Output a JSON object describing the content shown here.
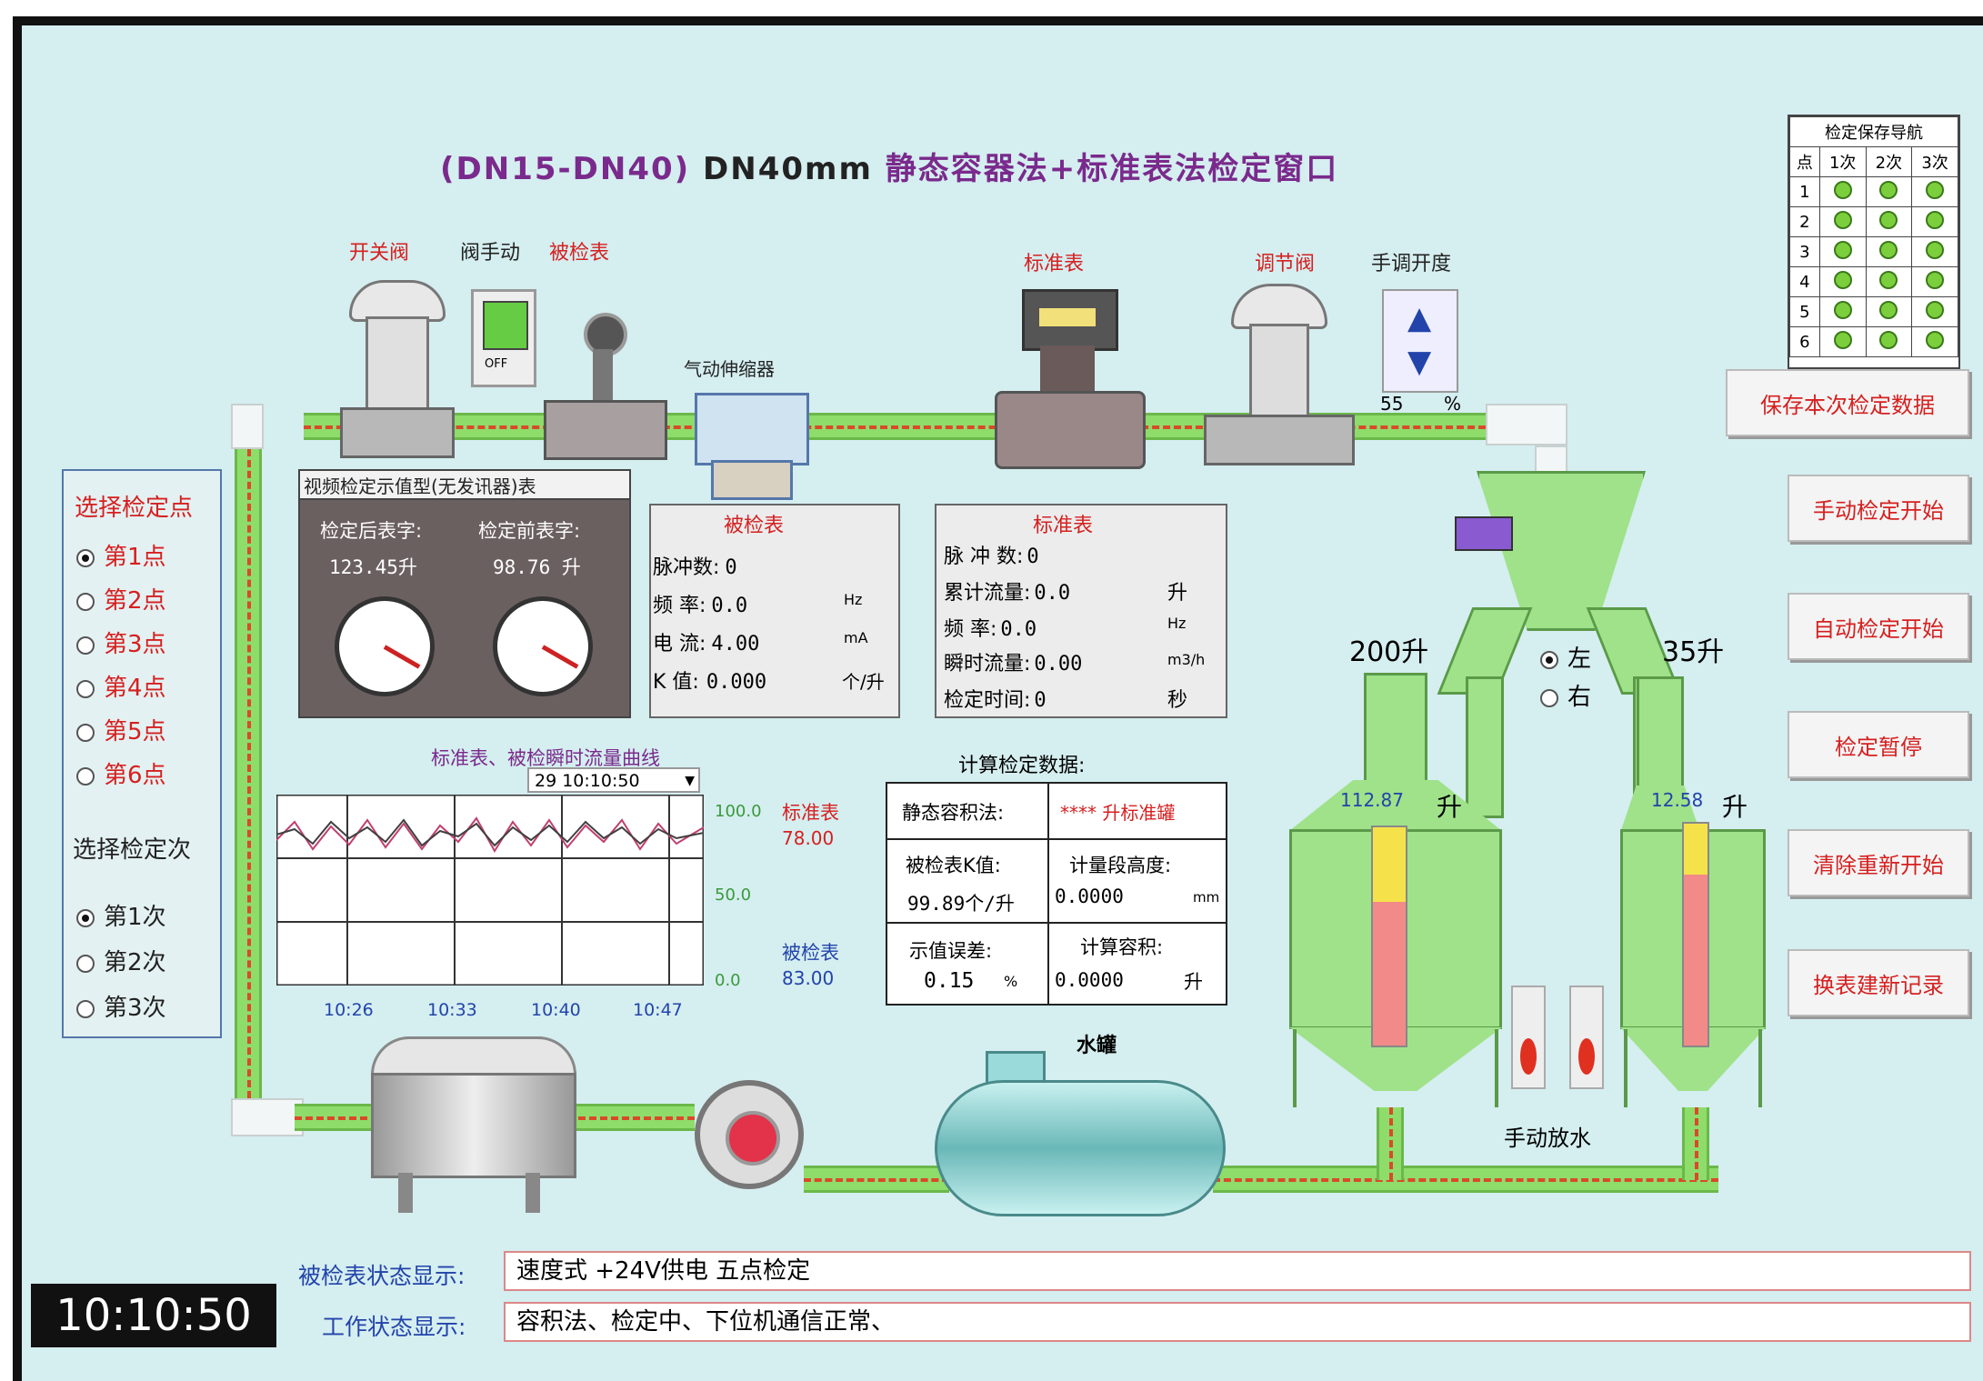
{
  "header": {
    "title_range": "(DN15-DN40)",
    "title_size": "DN40mm",
    "title_method": "静态容器法+标准表法检定窗口"
  },
  "devices": {
    "switch_valve": "开关阀",
    "valve_manual": "阀手动",
    "valve_manual_btn": "OFF",
    "meter_under_test": "被检表",
    "expander": "气动伸缩器",
    "standard_meter": "标准表",
    "regulating_valve": "调节阀",
    "manual_opening_label": "手调开度",
    "manual_opening_value": "55",
    "manual_opening_unit": "%"
  },
  "nav": {
    "title": "检定保存导航",
    "col_point": "点",
    "cols": [
      "1次",
      "2次",
      "3次"
    ],
    "rows": [
      "1",
      "2",
      "3",
      "4",
      "5",
      "6"
    ]
  },
  "buttons": {
    "save": "保存本次检定数据",
    "manual_start": "手动检定开始",
    "auto_start": "自动检定开始",
    "pause": "检定暂停",
    "reset": "清除重新开始",
    "new_record": "换表建新记录"
  },
  "select_point": {
    "title": "选择检定点",
    "options": [
      "第1点",
      "第2点",
      "第3点",
      "第4点",
      "第5点",
      "第6点"
    ],
    "selected": 0
  },
  "select_run": {
    "title": "选择检定次",
    "options": [
      "第1次",
      "第2次",
      "第3次"
    ],
    "selected": 0
  },
  "video_panel": {
    "title": "视频检定示值型(无发讯器)表",
    "after_label": "检定后表字:",
    "before_label": "检定前表字:",
    "after_value": "123.45升",
    "before_value": "98.76 升"
  },
  "mut_panel": {
    "title": "被检表",
    "rows": [
      {
        "label": "脉冲数:",
        "value": "0",
        "unit": ""
      },
      {
        "label": "频  率:",
        "value": "0.0",
        "unit": "Hz"
      },
      {
        "label": "电  流:",
        "value": "4.00",
        "unit": "mA"
      },
      {
        "label": "K 值:",
        "value": "0.000",
        "unit": "个/升"
      }
    ]
  },
  "std_panel": {
    "title": "标准表",
    "rows": [
      {
        "label": "脉 冲 数:",
        "value": "0",
        "unit": ""
      },
      {
        "label": "累计流量:",
        "value": "0.0",
        "unit": "升"
      },
      {
        "label": "频   率:",
        "value": "0.0",
        "unit": "Hz"
      },
      {
        "label": "瞬时流量:",
        "value": "0.00",
        "unit": "m3/h"
      },
      {
        "label": "检定时间:",
        "value": "0",
        "unit": "秒"
      }
    ]
  },
  "trend": {
    "title": "标准表、被检瞬时流量曲线",
    "timestamp": "29 10:10:50",
    "x_ticks": [
      "10:26",
      "10:33",
      "10:40",
      "10:47"
    ],
    "y_ticks": [
      "100.0",
      "50.0",
      "0.0"
    ],
    "std_label": "标准表",
    "std_value": "78.00",
    "mut_label": "被检表",
    "mut_value": "83.00"
  },
  "calc": {
    "title": "计算检定数据:",
    "static_label": "静态容积法:",
    "static_value": "**** 升标准罐",
    "k_label": "被检表K值:",
    "k_value": "99.89个/升",
    "height_label": "计量段高度:",
    "height_value": "0.0000",
    "height_unit": "mm",
    "error_label": "示值误差:",
    "error_value": "0.15",
    "error_unit": "%",
    "volume_label": "计算容积:",
    "volume_value": "0.0000",
    "volume_unit": "升"
  },
  "tanks": {
    "left_capacity": "200升",
    "right_capacity": "35升",
    "left_reading": "112.87",
    "right_reading": "12.58",
    "unit": "升",
    "divert_left": "左",
    "divert_right": "右",
    "divert_selected": "left",
    "manual_drain": "手动放水"
  },
  "water_tank_label": "水罐",
  "status": {
    "meter_label": "被检表状态显示:",
    "meter_value": "速度式   +24V供电   五点检定",
    "work_label": "工作状态显示:",
    "work_value": "容积法、检定中、下位机通信正常、"
  },
  "clock": "10:10:50",
  "colors": {
    "pipe": "#8edc6a",
    "accent_red": "#d62020",
    "title_purple": "#7a2a8c",
    "background": "#d5eef0"
  }
}
